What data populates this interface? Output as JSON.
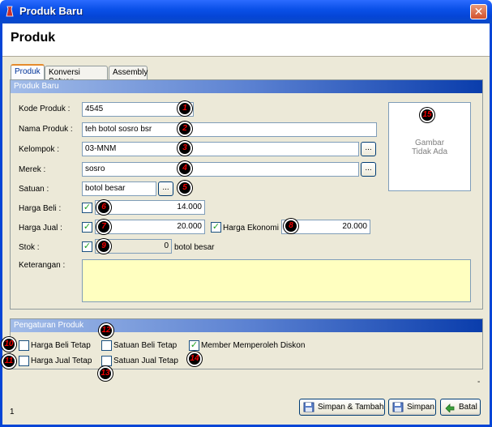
{
  "window": {
    "title": "Produk Baru",
    "close_glyph": "✕"
  },
  "page_title": "Produk",
  "tabs": [
    {
      "label": "Produk",
      "active": true
    },
    {
      "label": "Konversi Satuan",
      "active": false
    },
    {
      "label": "Assembly",
      "active": false
    }
  ],
  "section": {
    "title": "Produk Baru"
  },
  "fields": {
    "kode": {
      "label": "Kode Produk :",
      "value": "4545"
    },
    "nama": {
      "label": "Nama Produk :",
      "value": "teh botol sosro bsr"
    },
    "kelompok": {
      "label": "Kelompok :",
      "value": "03-MNM"
    },
    "merek": {
      "label": "Merek :",
      "value": "sosro"
    },
    "satuan": {
      "label": "Satuan :",
      "value": "botol besar"
    },
    "harga_beli": {
      "label": "Harga Beli :",
      "value": "14.000",
      "checked": true
    },
    "harga_jual": {
      "label": "Harga Jual :",
      "value": "20.000",
      "checked": true
    },
    "harga_ekonomi": {
      "label": "Harga Ekonomi :",
      "value": "20.000",
      "checked": true
    },
    "stok": {
      "label": "Stok :",
      "value": "0",
      "unit": "botol besar",
      "checked": true
    },
    "keterangan": {
      "label": "Keterangan :",
      "value": ""
    }
  },
  "browse_label": "...",
  "image_placeholder": {
    "line1": "Gambar",
    "line2": "Tidak Ada"
  },
  "pengaturan": {
    "title": "Pengaturan Produk",
    "harga_beli_tetap": {
      "label": "Harga Beli Tetap",
      "checked": false
    },
    "harga_jual_tetap": {
      "label": "Harga Jual Tetap",
      "checked": false
    },
    "satuan_beli_tetap": {
      "label": "Satuan Beli Tetap",
      "checked": false
    },
    "satuan_jual_tetap": {
      "label": "Satuan Jual Tetap",
      "checked": false
    },
    "member_diskon": {
      "label": "Member Memperoleh Diskon",
      "checked": true
    }
  },
  "markers": [
    "1",
    "2",
    "3",
    "4",
    "5",
    "6",
    "7",
    "8",
    "9",
    "10",
    "11",
    "12",
    "13",
    "14",
    "15"
  ],
  "buttons": {
    "simpan_tambah": "Simpan & Tambah",
    "simpan": "Simpan",
    "batal": "Batal"
  },
  "status": {
    "number": "1",
    "dash": "-"
  },
  "check_glyph": "✓",
  "icons": [
    "app-icon",
    "close-icon",
    "save-add-icon",
    "save-icon",
    "cancel-icon"
  ]
}
